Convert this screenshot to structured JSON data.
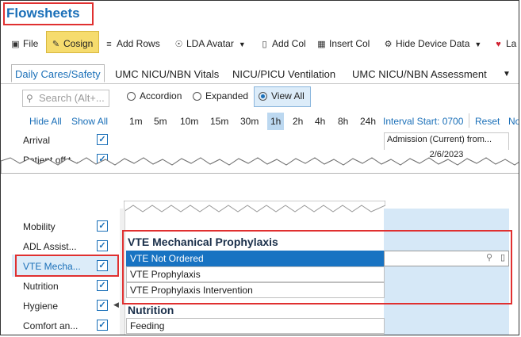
{
  "app": {
    "title": "Flowsheets"
  },
  "toolbar": {
    "file": "File",
    "cosign": "Cosign",
    "add_rows": "Add Rows",
    "lda_avatar": "LDA Avatar",
    "add_col": "Add Col",
    "insert_col": "Insert Col",
    "hide_device_data": "Hide Device Data",
    "la": "La"
  },
  "tabs": [
    "Daily Cares/Safety",
    "UMC NICU/NBN Vitals",
    "NICU/PICU Ventilation",
    "UMC NICU/NBN Assessment"
  ],
  "sidebar": {
    "search_placeholder": "Search (Alt+...",
    "hide_all": "Hide All",
    "show_all": "Show All",
    "items_top": [
      "Arrival",
      "Patient off t..."
    ],
    "items_bottom": [
      "Mobility",
      "ADL Assist...",
      "VTE Mecha...",
      "Nutrition",
      "Hygiene",
      "Comfort an..."
    ]
  },
  "view": {
    "accordion": "Accordion",
    "expanded": "Expanded",
    "view_all": "View All"
  },
  "intervals": [
    "1m",
    "5m",
    "10m",
    "15m",
    "30m",
    "1h",
    "2h",
    "4h",
    "8h",
    "24h"
  ],
  "interval_start": "Interval Start: 0700",
  "reset": "Reset",
  "now": "No",
  "column": {
    "header": "Admission (Current) from...",
    "date": "2/6/2023"
  },
  "grid": {
    "section_vte": "VTE Mechanical Prophylaxis",
    "rows_vte": [
      "VTE Not Ordered",
      "VTE Prophylaxis",
      "VTE Prophylaxis Intervention"
    ],
    "section_nutrition": "Nutrition",
    "rows_nutrition": [
      "Feeding"
    ]
  },
  "colors": {
    "accent": "#1a6fb8",
    "highlight": "#e03030",
    "selected_row": "#1873c2"
  }
}
